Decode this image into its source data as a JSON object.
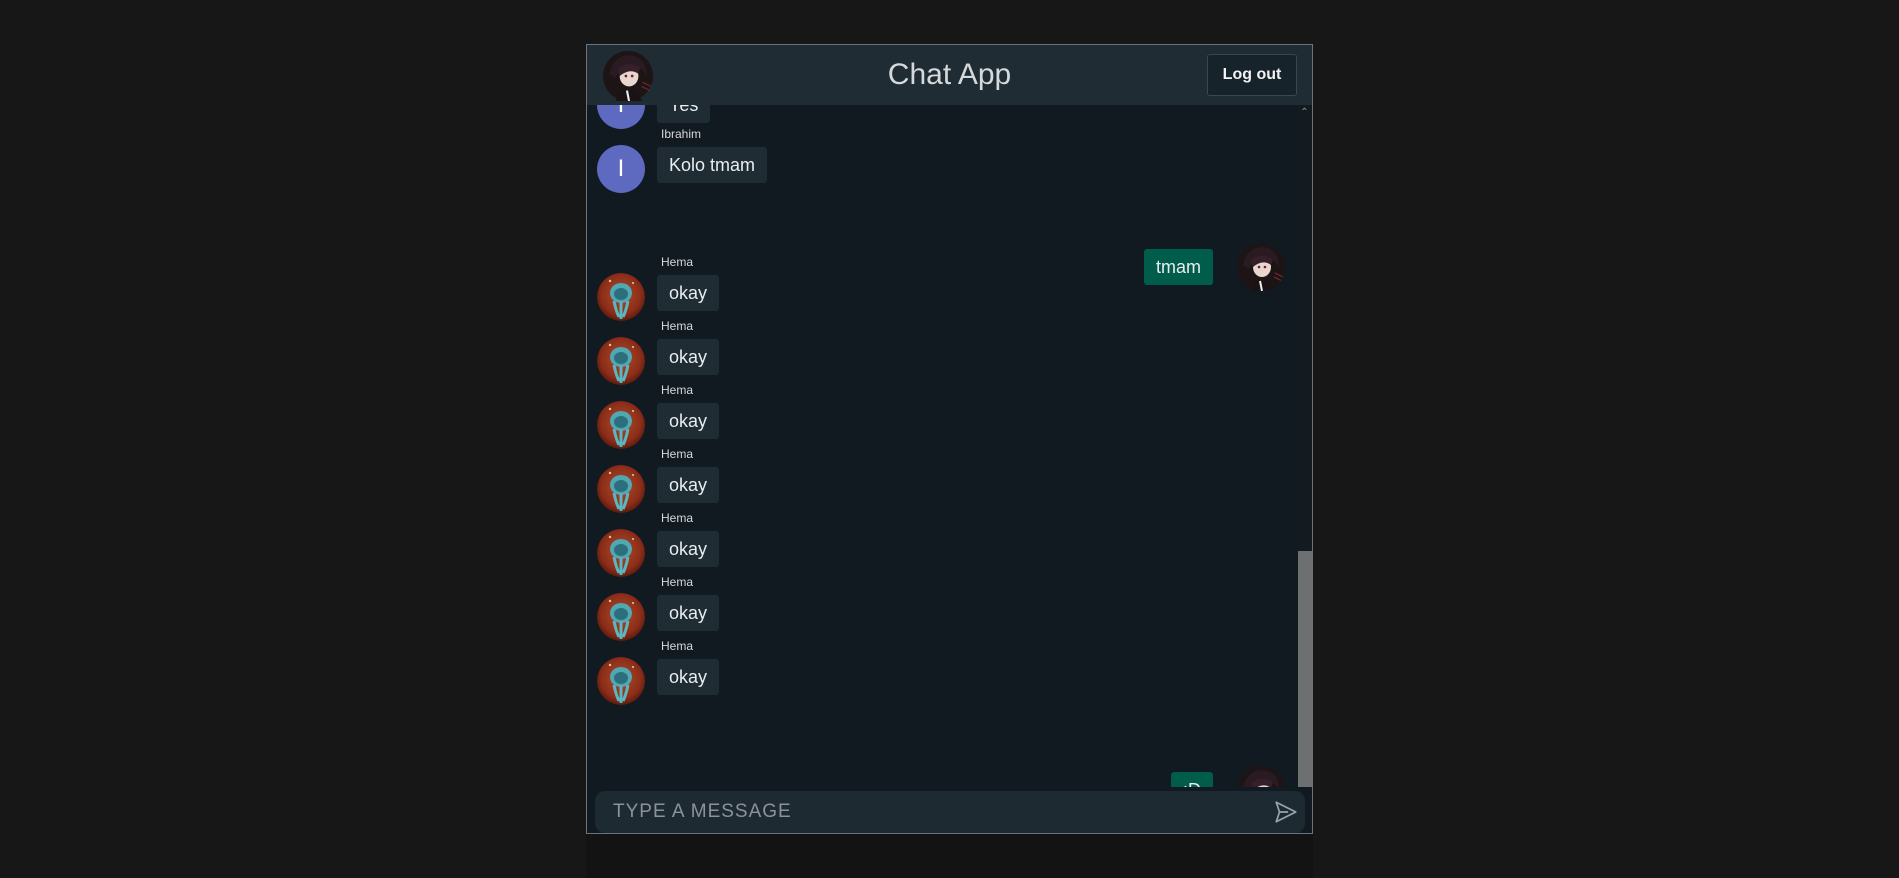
{
  "header": {
    "title": "Chat App",
    "logout_label": "Log out",
    "current_user_avatar": "anime-character-avatar"
  },
  "messages": [
    {
      "type": "incoming",
      "sender": "",
      "avatar_letter": "I",
      "text": "Yes"
    },
    {
      "type": "incoming",
      "sender": "Ibrahim",
      "avatar_letter": "I",
      "text": "Kolo tmam"
    },
    {
      "type": "outgoing",
      "text": "tmam"
    },
    {
      "type": "incoming",
      "sender": "Hema",
      "avatar": "jellyfish-avatar",
      "text": "okay"
    },
    {
      "type": "incoming",
      "sender": "Hema",
      "avatar": "jellyfish-avatar",
      "text": "okay"
    },
    {
      "type": "incoming",
      "sender": "Hema",
      "avatar": "jellyfish-avatar",
      "text": "okay"
    },
    {
      "type": "incoming",
      "sender": "Hema",
      "avatar": "jellyfish-avatar",
      "text": "okay"
    },
    {
      "type": "incoming",
      "sender": "Hema",
      "avatar": "jellyfish-avatar",
      "text": "okay"
    },
    {
      "type": "incoming",
      "sender": "Hema",
      "avatar": "jellyfish-avatar",
      "text": "okay"
    },
    {
      "type": "incoming",
      "sender": "Hema",
      "avatar": "jellyfish-avatar",
      "text": "okay"
    },
    {
      "type": "outgoing",
      "text": ":D"
    }
  ],
  "composer": {
    "placeholder": "TYPE A MESSAGE",
    "value": "",
    "send_icon": "send-icon"
  },
  "colors": {
    "incoming_bubble": "#202c33",
    "outgoing_bubble": "#005c4b",
    "letter_avatar": "#5e6ac0",
    "header": "#202c33",
    "chat_background": "#111a21"
  }
}
